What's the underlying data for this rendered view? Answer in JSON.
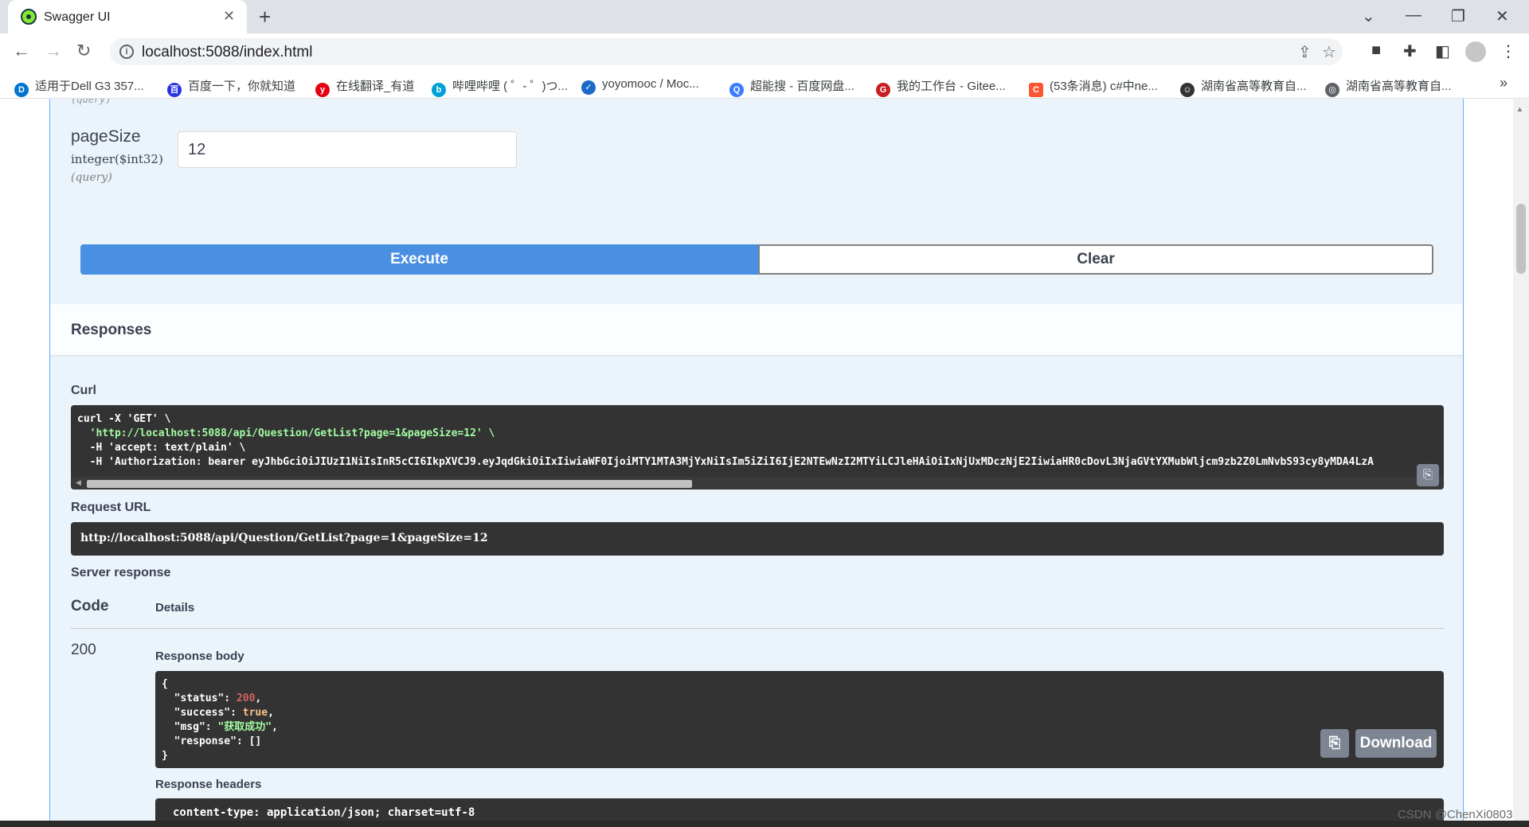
{
  "browser": {
    "tab_title": "Swagger UI",
    "tab_close": "✕",
    "new_tab": "+",
    "window_buttons": [
      "⌄",
      "—",
      "❐",
      "✕"
    ],
    "url": "localhost:5088/index.html",
    "nav": {
      "back": "←",
      "forward": "→",
      "reload": "↻"
    },
    "bookmarks": [
      {
        "label": "适用于Dell G3 357...",
        "icon": "dell-icon",
        "color": "#0076ce"
      },
      {
        "label": "百度一下，你就知道",
        "icon": "baidu-icon",
        "color": "#2932e1"
      },
      {
        "label": "在线翻译_有道",
        "icon": "youdao-icon",
        "color": "#e60012"
      },
      {
        "label": "哔哩哔哩 ( ゜- ゜)つ...",
        "icon": "bilibili-icon",
        "color": "#00a1d6"
      },
      {
        "label": "yoyomooc / Moc...",
        "icon": "shield-icon",
        "color": "#1b6ac9"
      },
      {
        "label": "超能搜 - 百度网盘...",
        "icon": "search-app-icon",
        "color": "#3b7cff"
      },
      {
        "label": "我的工作台 - Gitee...",
        "icon": "gitee-icon",
        "color": "#c71d23"
      },
      {
        "label": "(53条消息) c#中ne...",
        "icon": "csdn-icon",
        "color": "#fc5531"
      },
      {
        "label": "湖南省高等教育自...",
        "icon": "penguin-icon",
        "color": "#333333"
      },
      {
        "label": "湖南省高等教育自...",
        "icon": "globe-icon",
        "color": "#5f6368"
      }
    ],
    "bookmarks_more": "»"
  },
  "param": {
    "prev_in": "(query)",
    "name": "pageSize",
    "type": "integer($int32)",
    "in": "(query)",
    "value": "12"
  },
  "actions": {
    "execute": "Execute",
    "clear": "Clear"
  },
  "responses": {
    "title": "Responses",
    "curl_label": "Curl",
    "curl_lines": [
      "curl -X 'GET' \\",
      "  'http://localhost:5088/api/Question/GetList?page=1&pageSize=12' \\",
      "  -H 'accept: text/plain' \\",
      "  -H 'Authorization: bearer eyJhbGciOiJIUzI1NiIsInR5cCI6IkpXVCJ9.eyJqdGkiOiIxIiwiaWF0IjoiMTY1MTA3MjYxNiIsIm5iZiI6IjE2NTEwNzI2MTYiLCJleHAiOiIxNjUxMDczNjE2IiwiaHR0cDovL3NjaGVtYXMubWljcm9zb2Z0LmNvbS93cy8yMDA4LzA"
    ],
    "request_url_label": "Request URL",
    "request_url": "http://localhost:5088/api/Question/GetList?page=1&pageSize=12",
    "server_response_label": "Server response",
    "code_header": "Code",
    "details_header": "Details",
    "code": "200",
    "body_label": "Response body",
    "body": {
      "open": "{",
      "k1": "\"status\"",
      "v1": "200",
      "k2": "\"success\"",
      "v2": "true",
      "k3": "\"msg\"",
      "v3": "\"获取成功\"",
      "k4": "\"response\"",
      "v4": "[]",
      "close": "}"
    },
    "download": "Download",
    "headers_label": "Response headers",
    "headers_line": "content-type: application/json; charset=utf-8"
  },
  "watermark": "CSDN @ChenXi0803",
  "colors": {
    "execute": "#4990e2",
    "opblock_border": "#61affe",
    "opblock_bg": "#ebf3fb",
    "code_bg": "#333333"
  }
}
